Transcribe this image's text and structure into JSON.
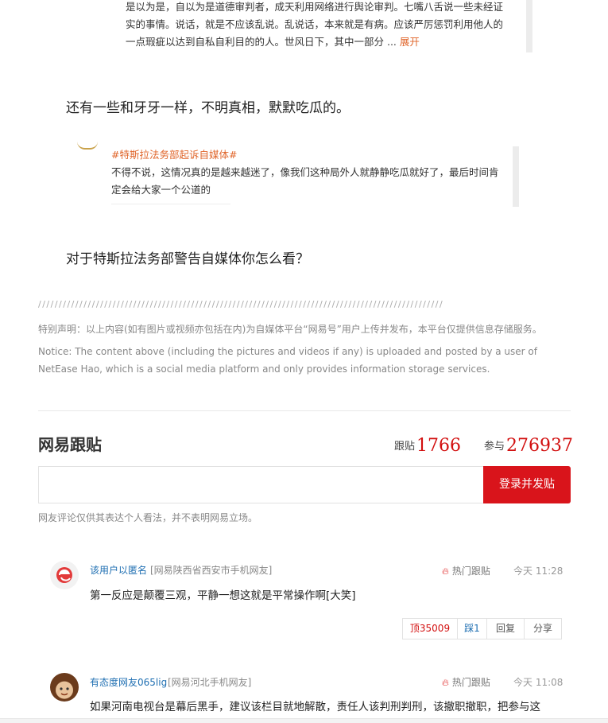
{
  "quote1": {
    "text": "是以为是，自以为是道德审判者，成天利用网络进行舆论审判。七嘴八舌说一些未经证实的事情。说话，就是不应该乱说。乱说话，本来就是有病。应该严厉惩罚利用他人的一点瑕疵以达到自私自利目的的人。世风日下，其中一部分 ...",
    "expand": "展开"
  },
  "para1": "还有一些和牙牙一样，不明真相，默默吃瓜的。",
  "quote2": {
    "tag": "#特斯拉法务部起诉自媒体#",
    "text": "不得不说，这情况真的是越来越迷了，像我们这种局外人就静静吃瓜就好了，最后时间肯定会给大家一个公道的"
  },
  "para2": "对于特斯拉法务部警告自媒体你怎么看？",
  "divider": "//////////////////////////////////////////////////////////////////////////////////////////////////",
  "statement": {
    "cn": "特别声明：以上内容(如有图片或视频亦包括在内)为自媒体平台“网易号”用户上传并发布，本平台仅提供信息存储服务。",
    "en": "Notice: The content above (including the pictures and videos if any) is uploaded and posted by a user of NetEase Hao, which is a social media platform and only provides information storage services."
  },
  "comments_section": {
    "title": "网易跟贴",
    "follow_label": "跟贴",
    "follow_count": "1766",
    "join_label": "参与",
    "join_count": "276937",
    "input_placeholder": "",
    "post_button": "登录并发贴",
    "disclaimer": "网友评论仅供其表达个人看法，并不表明网易立场。"
  },
  "comments": [
    {
      "user": "该用户以匿名",
      "location": "[网易陕西省西安市手机网友]",
      "hot": "热门跟贴",
      "time": "今天 11:28",
      "text": "第一反应是颠覆三观，平静一想这就是平常操作啊[大笑]",
      "up": "顶35009",
      "down": "踩1",
      "reply": "回复",
      "share": "分享",
      "avatar_icon": "netease-logo-icon"
    },
    {
      "user": "有态度网友065lig",
      "location": "[网易河北手机网友]",
      "hot": "热门跟贴",
      "time": "今天 11:08",
      "text": "如果河南电视台是幕后黑手，建议该栏目就地解散，责任人该判刑判刑，该撤职撤职，把参与这",
      "avatar_icon": "cartoon-avatar-icon"
    }
  ],
  "colors": {
    "accent_red": "#d9141b",
    "link_blue": "#1f6fb2",
    "tag_orange": "#e0662b"
  }
}
